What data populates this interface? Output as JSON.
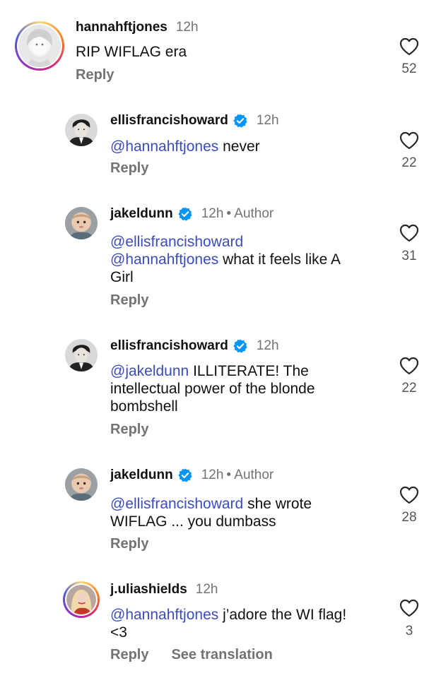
{
  "colors": {
    "mention": "#3b4cc0",
    "verified": "#0095f6",
    "muted": "#737373"
  },
  "icons": {
    "like": "heart-outline-icon",
    "verified": "verified-badge-icon",
    "mention": "threads-at-icon"
  },
  "comments": [
    {
      "username": "hannahftjones",
      "time": "12h",
      "verified": false,
      "author": "",
      "mentions": [],
      "text_lines": [
        "RIP WIFLAG era"
      ],
      "reply": "Reply",
      "likes": "52"
    },
    {
      "username": "ellisfrancishoward",
      "time": "12h",
      "verified": true,
      "author": "",
      "mentions": [
        "@hannahftjones"
      ],
      "text": " never",
      "reply": "Reply",
      "likes": "22"
    },
    {
      "username": "jakeldunn",
      "time": "12h",
      "verified": true,
      "author": "• Author",
      "mentions": [
        "@ellisfrancishoward",
        "@hannahftjones"
      ],
      "text": " what it feels like A",
      "text_line3": "Girl",
      "reply": "Reply",
      "likes": "31"
    },
    {
      "username": "ellisfrancishoward",
      "time": "12h",
      "verified": true,
      "author": "",
      "mentions": [
        "@jakeldunn"
      ],
      "text": " ILLITERATE! The",
      "text_line2": "intellectual power of the blonde",
      "text_line3": "bombshell",
      "reply": "Reply",
      "likes": "22"
    },
    {
      "username": "jakeldunn",
      "time": "12h",
      "verified": true,
      "author": "• Author",
      "mentions": [
        "@ellisfrancishoward"
      ],
      "text": " she wrote",
      "text_line2": "WIFLAG ... you dumbass",
      "reply": "Reply",
      "likes": "28"
    },
    {
      "username": "j.uliashields",
      "time": "12h",
      "verified": false,
      "author": "",
      "mentions": [
        "@hannahftjones"
      ],
      "text": " j’adore the WI flag!",
      "text_line2": "<3",
      "reply": "Reply",
      "see_translation": "See translation",
      "likes": "3"
    }
  ]
}
